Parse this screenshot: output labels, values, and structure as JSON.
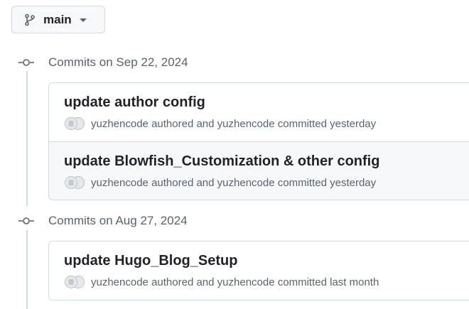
{
  "branch": {
    "name": "main",
    "icon": "git-branch-icon",
    "dropdown_icon": "triangle-down-icon"
  },
  "groups": [
    {
      "title": "Commits on Sep 22, 2024",
      "commits": [
        {
          "message": "update author config",
          "author": "yuzhencode",
          "authored_text": "authored and",
          "committer": "yuzhencode",
          "committed_text": "committed",
          "time": "yesterday"
        },
        {
          "message": "update Blowfish_Customization & other config",
          "author": "yuzhencode",
          "authored_text": "authored and",
          "committer": "yuzhencode",
          "committed_text": "committed",
          "time": "yesterday"
        }
      ]
    },
    {
      "title": "Commits on Aug 27, 2024",
      "commits": [
        {
          "message": "update Hugo_Blog_Setup",
          "author": "yuzhencode",
          "authored_text": "authored and",
          "committer": "yuzhencode",
          "committed_text": "committed",
          "time": "last month"
        }
      ]
    }
  ],
  "colors": {
    "border": "#d1d9e0",
    "muted_text": "#59636e",
    "primary_text": "#1f2328",
    "hover_row": "#f6f8fa"
  }
}
